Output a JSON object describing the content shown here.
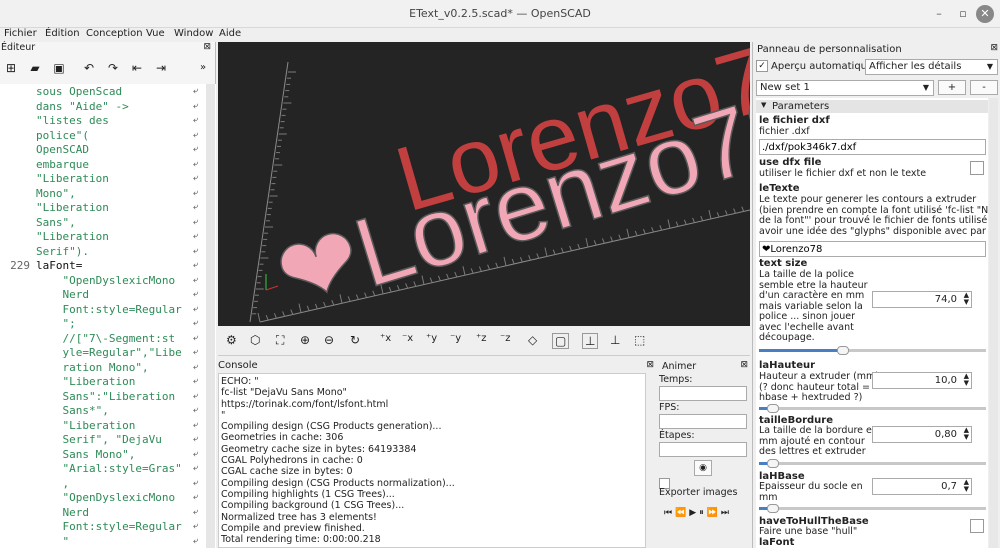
{
  "window": {
    "title": "EText_v0.2.5.scad* — OpenSCAD"
  },
  "menu": [
    "Fichier",
    "Édition",
    "Conception",
    "Vue",
    "Window",
    "Aide"
  ],
  "editor": {
    "title": "Éditeur",
    "lines": [
      {
        "n": "",
        "t": "sous OpenScad",
        "s": true
      },
      {
        "n": "",
        "t": "dans \"Aide\" ->",
        "s": true
      },
      {
        "n": "",
        "t": "\"listes des",
        "s": true
      },
      {
        "n": "",
        "t": "police\"(",
        "s": true
      },
      {
        "n": "",
        "t": "OpenSCAD",
        "s": true
      },
      {
        "n": "",
        "t": "embarque",
        "s": true
      },
      {
        "n": "",
        "t": "\"Liberation",
        "s": true
      },
      {
        "n": "",
        "t": "Mono\",",
        "s": true
      },
      {
        "n": "",
        "t": "\"Liberation",
        "s": true
      },
      {
        "n": "",
        "t": "Sans\",",
        "s": true
      },
      {
        "n": "",
        "t": "\"Liberation",
        "s": true
      },
      {
        "n": "",
        "t": "Serif\").",
        "s": true
      },
      {
        "n": "229",
        "t": "laFont=",
        "s": false
      },
      {
        "n": "",
        "t": "    \"OpenDyslexicMono",
        "s": true
      },
      {
        "n": "",
        "t": "    Nerd",
        "s": true
      },
      {
        "n": "",
        "t": "    Font:style=Regular",
        "s": true
      },
      {
        "n": "",
        "t": "    \";",
        "s": true
      },
      {
        "n": "",
        "t": "    //[\"7\\-Segment:st",
        "s": true
      },
      {
        "n": "",
        "t": "    yle=Regular\",\"Libe",
        "s": true
      },
      {
        "n": "",
        "t": "    ration Mono\",",
        "s": true
      },
      {
        "n": "",
        "t": "    \"Liberation",
        "s": true
      },
      {
        "n": "",
        "t": "    Sans\":\"Liberation",
        "s": true
      },
      {
        "n": "",
        "t": "    Sans*\",",
        "s": true
      },
      {
        "n": "",
        "t": "    \"Liberation",
        "s": true
      },
      {
        "n": "",
        "t": "    Serif\", \"DejaVu",
        "s": true
      },
      {
        "n": "",
        "t": "    Sans Mono\",",
        "s": true
      },
      {
        "n": "",
        "t": "    \"Arial:style=Gras\"",
        "s": true
      },
      {
        "n": "",
        "t": "    ,",
        "s": true
      },
      {
        "n": "",
        "t": "    \"OpenDyslexicMono",
        "s": true
      },
      {
        "n": "",
        "t": "    Nerd",
        "s": true
      },
      {
        "n": "",
        "t": "    Font:style=Regular",
        "s": true
      },
      {
        "n": "",
        "t": "    \"",
        "s": true
      }
    ]
  },
  "viewport": {
    "text": "❤Lorenzo78",
    "shadow": "Lorenzo78"
  },
  "console": {
    "title": "Console",
    "lines": [
      "ECHO: \"",
      "fc-list \"DejaVu Sans Mono\"",
      "https://torinak.com/font/lsfont.html",
      "\"",
      "Compiling design (CSG Products generation)...",
      "Geometries in cache: 306",
      "Geometry cache size in bytes: 64193384",
      "CGAL Polyhedrons in cache: 0",
      "CGAL cache size in bytes: 0",
      "Compiling design (CSG Products normalization)...",
      "Compiling highlights (1 CSG Trees)...",
      "Compiling background (1 CSG Trees)...",
      "Normalized tree has 3 elements!",
      "Compile and preview finished.",
      "Total rendering time: 0:00:00.218"
    ]
  },
  "animer": {
    "title": "Animer",
    "temps": "Temps:",
    "fps": "FPS:",
    "etapes": "Étapes:",
    "export": "Exporter images"
  },
  "panel": {
    "title": "Panneau de personnalisation",
    "apercu": "Aperçu automatique",
    "details": "Afficher les détails",
    "set": "New set 1",
    "plus": "+",
    "minus": "-",
    "section": "Parameters",
    "p1": {
      "name": "le fichier dxf",
      "desc": "fichier .dxf",
      "value": "./dxf/pok346k7.dxf"
    },
    "p2": {
      "name": "use dfx file",
      "desc": "utiliser le fichier dxf et non le texte"
    },
    "p3": {
      "name": "leTexte",
      "desc1": "Le texte pour generer les contours a extruder",
      "desc2": "(bien prendre en compte la font utilisé 'fc-list \"Nom",
      "desc3": "de la font\"' pour trouvé le fichier de fonts utilisé et",
      "desc4": "avoir une idée des \"glyphs\" disponible avec par",
      "value": "❤Lorenzo78"
    },
    "p4": {
      "name": "text size",
      "d1": "La taille de la police",
      "d2": "semble etre la hauteur",
      "d3": "d'un caractère en mm",
      "d4": "mais variable selon la",
      "d5": "police ... sinon jouer",
      "d6": "avec l'echelle avant",
      "d7": "découpage.",
      "value": "74,0",
      "fill": 0.37
    },
    "p5": {
      "name": "laHauteur",
      "d1": "Hauteur a extruder (mm)",
      "d2": "(? donc hauteur total =",
      "d3": "hbase + hextruded ?)",
      "value": "10,0",
      "fill": 0.06
    },
    "p6": {
      "name": "tailleBordure",
      "d1": "La taille de la bordure en",
      "d2": "mm ajouté en contour",
      "d3": "des lettres et extruder",
      "value": "0,80",
      "fill": 0.06
    },
    "p7": {
      "name": "laHBase",
      "d1": "Epaisseur du socle en",
      "d2": "mm",
      "value": "0,7",
      "fill": 0.06
    },
    "p8": {
      "name": "haveToHullTheBase",
      "d1": "Faire une base \"hull\""
    },
    "p9": {
      "name": "laFont"
    }
  }
}
